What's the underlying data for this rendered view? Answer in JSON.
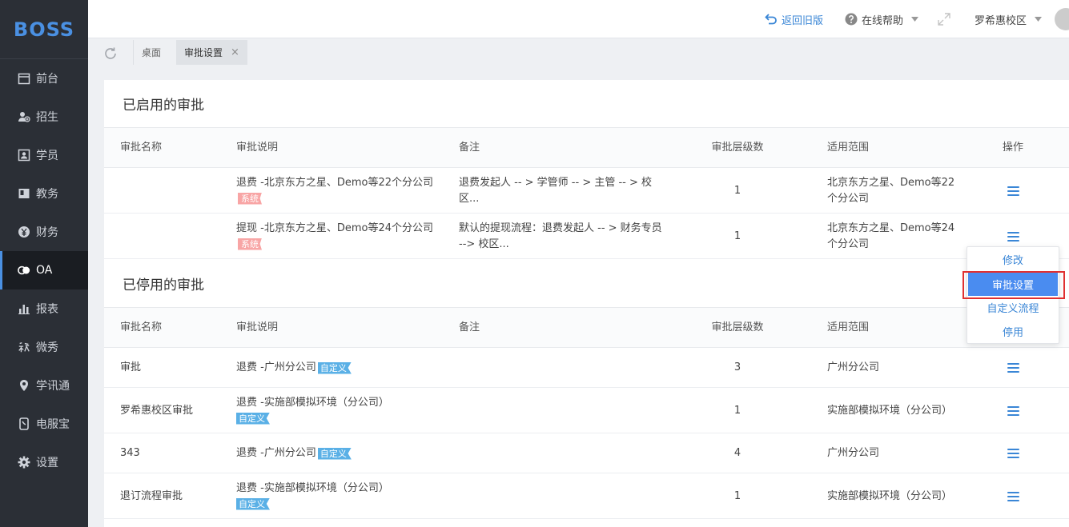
{
  "app": {
    "logo": "BOSS"
  },
  "sidebar": {
    "items": [
      {
        "label": "前台",
        "icon": "calendar-icon"
      },
      {
        "label": "招生",
        "icon": "user-plus-icon"
      },
      {
        "label": "学员",
        "icon": "id-card-icon"
      },
      {
        "label": "教务",
        "icon": "book-icon"
      },
      {
        "label": "财务",
        "icon": "yen-icon"
      },
      {
        "label": "OA",
        "icon": "oa-icon",
        "active": true
      },
      {
        "label": "报表",
        "icon": "bar-chart-icon"
      },
      {
        "label": "微秀",
        "icon": "show-icon"
      },
      {
        "label": "学讯通",
        "icon": "location-pin-icon"
      },
      {
        "label": "电服宝",
        "icon": "phone-icon"
      },
      {
        "label": "设置",
        "icon": "gear-icon"
      }
    ]
  },
  "topbar": {
    "back_label": "返回旧版",
    "help_label": "在线帮助",
    "campus_label": "罗希惠校区"
  },
  "tabs": {
    "desk_label": "桌面",
    "approval_label": "审批设置",
    "close_glyph": "×"
  },
  "enabled": {
    "title": "已启用的审批",
    "headers": {
      "name": "审批名称",
      "desc": "审批说明",
      "note": "备注",
      "level": "审批层级数",
      "scope": "适用范围",
      "op": "操作"
    },
    "rows": [
      {
        "name": "",
        "desc": "退费 -北京东方之星、Demo等22个分公司",
        "tag": "系统",
        "note": "退费发起人 -- > 学管师 -- > 主管 -- > 校区...",
        "level": "1",
        "scope": "北京东方之星、Demo等22个分公司"
      },
      {
        "name": "",
        "desc": "提现 -北京东方之星、Demo等24个分公司",
        "tag": "系统",
        "note": "默认的提现流程：退费发起人 -- > 财务专员 --> 校区...",
        "level": "1",
        "scope": "北京东方之星、Demo等24个分公司"
      }
    ]
  },
  "disabled": {
    "title": "已停用的审批",
    "headers": {
      "name": "审批名称",
      "desc": "审批说明",
      "note": "备注",
      "level": "审批层级数",
      "scope": "适用范围"
    },
    "rows": [
      {
        "name": "审批",
        "desc": "退费 -广州分公司",
        "tag": "自定义",
        "note": "",
        "level": "3",
        "scope": "广州分公司"
      },
      {
        "name": "罗希惠校区审批",
        "desc": "退费 -实施部模拟环境（分公司）",
        "tag": "自定义",
        "note": "",
        "level": "1",
        "scope": "实施部模拟环境（分公司）"
      },
      {
        "name": "343",
        "desc": "退费 -广州分公司",
        "tag": "自定义",
        "note": "",
        "level": "4",
        "scope": "广州分公司"
      },
      {
        "name": "退订流程审批",
        "desc": "退费 -实施部模拟环境（分公司）",
        "tag": "自定义",
        "note": "",
        "level": "1",
        "scope": "实施部模拟环境（分公司）"
      }
    ]
  },
  "dropdown": {
    "items": [
      "修改",
      "审批设置",
      "自定义流程",
      "停用"
    ],
    "selected": "审批设置"
  },
  "colors": {
    "accent": "#3a86d6",
    "sidebar_bg": "#2b2f36",
    "selected_item": "#4a8cf0",
    "highlight_border": "#e03030"
  }
}
